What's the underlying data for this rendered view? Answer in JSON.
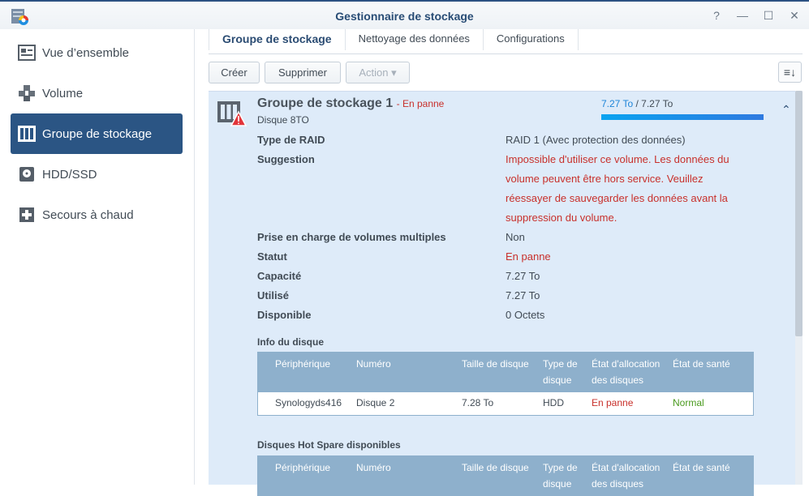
{
  "window": {
    "title": "Gestionnaire de stockage",
    "buttons": [
      "?",
      "—",
      "☐",
      "✕"
    ]
  },
  "sidebar": {
    "items": [
      {
        "label": "Vue d’ensemble",
        "icon": "overview-icon"
      },
      {
        "label": "Volume",
        "icon": "volume-cubes-icon"
      },
      {
        "label": "Groupe de stockage",
        "icon": "storage-pool-icon",
        "active": true
      },
      {
        "label": "HDD/SSD",
        "icon": "hdd-icon"
      },
      {
        "label": "Secours à chaud",
        "icon": "hot-spare-icon"
      }
    ]
  },
  "tabs": [
    {
      "label": "Groupe de stockage",
      "active": true
    },
    {
      "label": "Nettoyage des données"
    },
    {
      "label": "Configurations"
    }
  ],
  "toolbar": {
    "create": "Créer",
    "delete": "Supprimer",
    "action": "Action ▾",
    "sort_icon": "≡↓"
  },
  "pool": {
    "name": "Groupe de stockage 1",
    "status_suffix": "- En panne",
    "subtitle": "Disque 8TO",
    "used": "7.27 To",
    "total": " / 7.27 To",
    "usage_fraction": 1.0,
    "details": [
      {
        "label": "Type de RAID",
        "value": "RAID 1 (Avec protection des données)",
        "error": false
      },
      {
        "label": "Suggestion",
        "value": "Impossible d'utiliser ce volume. Les données du volume peuvent être hors service. Veuillez réessayer de sauvegarder les données avant la suppression du volume.",
        "error": true
      },
      {
        "label": "Prise en charge de volumes multiples",
        "value": "Non",
        "error": false
      },
      {
        "label": "Statut",
        "value": "En panne",
        "error": true
      },
      {
        "label": "Capacité",
        "value": "7.27 To",
        "error": false
      },
      {
        "label": "Utilisé",
        "value": "7.27 To",
        "error": false
      },
      {
        "label": "Disponible",
        "value": "0 Octets",
        "error": false
      }
    ]
  },
  "disk_info": {
    "title": "Info du disque",
    "headers": [
      "Périphérique",
      "Numéro",
      "Taille de disque",
      "Type de disque",
      "État d'allocation des disques",
      "État de santé"
    ],
    "rows": [
      [
        "Synologyds416",
        "Disque 2",
        "7.28 To",
        "HDD",
        "En panne",
        "Normal"
      ]
    ]
  },
  "hot_spare": {
    "title": "Disques Hot Spare disponibles",
    "headers": [
      "Périphérique",
      "Numéro",
      "Taille de disque",
      "Type de disque",
      "État d'allocation des disques",
      "État de santé"
    ]
  }
}
